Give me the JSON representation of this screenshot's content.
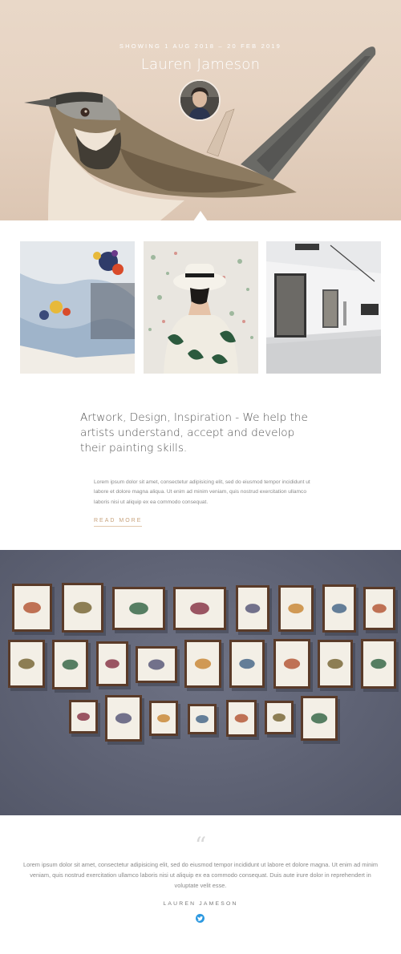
{
  "hero": {
    "showing": "SHOWING 1 AUG 2018 – 20 FEB 2019",
    "name": "Lauren Jameson"
  },
  "gallery": [
    {
      "name": "paint-palette-image"
    },
    {
      "name": "woman-in-hat-image"
    },
    {
      "name": "gallery-room-image"
    }
  ],
  "intro": {
    "headline": "Artwork, Design, Inspiration - We help the artists understand, accept and develop their painting skills.",
    "body": "Lorem ipsum dolor sit amet, consectetur adipisicing elit, sed do eiusmod tempor incididunt ut labore et dolore magna aliqua. Ut enim ad minim veniam, quis nostrud exercitation ullamco laboris nisi ut aliquip ex ea commodo consequat.",
    "read_more": "READ MORE"
  },
  "testimonial": {
    "quote": "Lorem ipsum dolor sit amet, consectetur adipisicing elit, sed do eiusmod tempor incididunt ut labore et dolore magna. Ut enim ad minim veniam, quis nostrud exercitation ullamco laboris nisi ut aliquip ex ea commodo consequat. Duis aute irure dolor in reprehendert in voluptate velit esse.",
    "author": "LAUREN JAMESON",
    "social_icon": "twitter-icon"
  },
  "colors": {
    "accent": "#c7a27c",
    "twitter": "#2b98e0",
    "wall": "#5f6375"
  }
}
